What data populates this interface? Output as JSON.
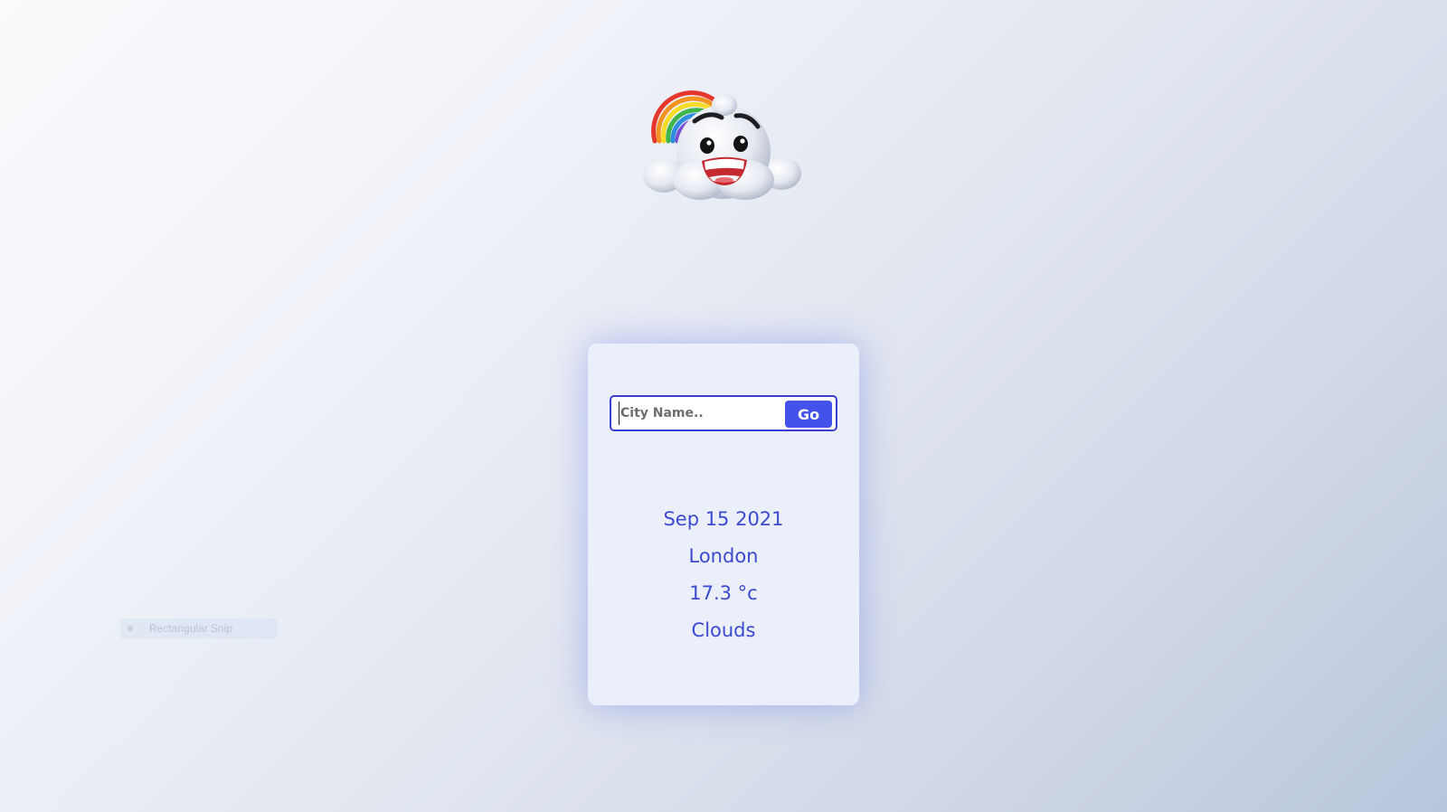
{
  "search": {
    "placeholder": "City Name..",
    "value": "",
    "go_label": "Go"
  },
  "weather": {
    "date": "Sep 15 2021",
    "city": "London",
    "temperature": "17.3 °c",
    "condition": "Clouds"
  },
  "overlay": {
    "snip_label": "Rectangular Snip"
  },
  "theme": {
    "accent": "#4452ec",
    "text": "#3b4ad0",
    "card_background": "#ebeffa"
  },
  "icons": {
    "mascot": "smiling-cloud-rainbow-icon"
  }
}
